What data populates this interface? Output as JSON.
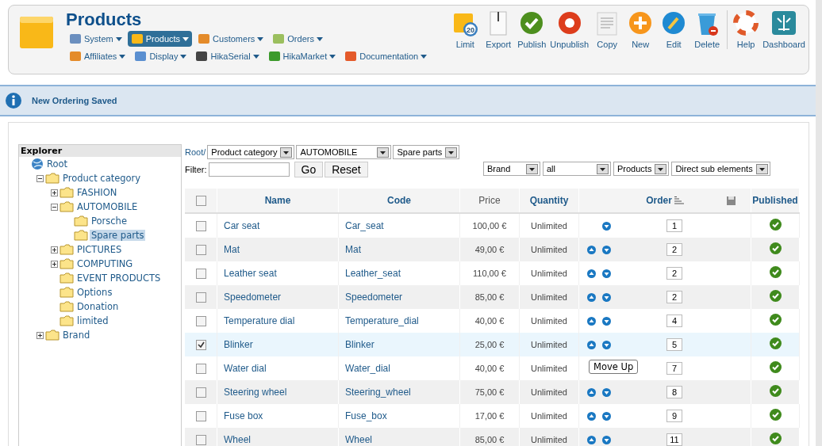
{
  "header": {
    "title": "Products",
    "menu_rows": [
      [
        {
          "label": "System",
          "selected": false
        },
        {
          "label": "Products",
          "selected": true
        },
        {
          "label": "Customers",
          "selected": false
        },
        {
          "label": "Orders",
          "selected": false
        }
      ],
      [
        {
          "label": "Affiliates",
          "selected": false
        },
        {
          "label": "Display",
          "selected": false
        },
        {
          "label": "HikaSerial",
          "selected": false
        },
        {
          "label": "HikaMarket",
          "selected": false
        },
        {
          "label": "Documentation",
          "selected": false
        }
      ]
    ],
    "toolbar": [
      {
        "label": "Limit",
        "badge": "20"
      },
      {
        "label": "Export"
      },
      {
        "label": "Publish"
      },
      {
        "label": "Unpublish"
      },
      {
        "label": "Copy"
      },
      {
        "label": "New"
      },
      {
        "label": "Edit"
      },
      {
        "label": "Delete"
      },
      {
        "label": "Help"
      },
      {
        "label": "Dashboard"
      }
    ]
  },
  "message": "New Ordering Saved",
  "explorer": {
    "title": "Explorer",
    "tree": [
      {
        "label": "Root",
        "kind": "root",
        "selected": false,
        "children": [
          {
            "label": "Product category",
            "kind": "folder",
            "selected": false,
            "expanded": true,
            "children": [
              {
                "label": "FASHION",
                "kind": "folder",
                "selected": false,
                "expanded": false
              },
              {
                "label": "AUTOMOBILE",
                "kind": "folder",
                "selected": false,
                "expanded": true,
                "children": [
                  {
                    "label": "Porsche",
                    "kind": "folder",
                    "selected": false
                  },
                  {
                    "label": "Spare parts",
                    "kind": "folder",
                    "selected": true
                  }
                ]
              },
              {
                "label": "PICTURES",
                "kind": "folder",
                "selected": false,
                "expanded": false
              },
              {
                "label": "COMPUTING",
                "kind": "folder",
                "selected": false,
                "expanded": false
              },
              {
                "label": "EVENT PRODUCTS",
                "kind": "folder",
                "selected": false
              },
              {
                "label": "Options",
                "kind": "folder",
                "selected": false
              },
              {
                "label": "Donation",
                "kind": "folder",
                "selected": false
              },
              {
                "label": "limited",
                "kind": "folder",
                "selected": false
              }
            ]
          },
          {
            "label": "Brand",
            "kind": "folder",
            "selected": false,
            "expanded": false
          }
        ]
      }
    ]
  },
  "breadcrumb": {
    "root": "Root/",
    "selects": [
      "Product category",
      "AUTOMOBILE",
      "Spare parts"
    ]
  },
  "filter": {
    "label": "Filter:",
    "buttons": [
      "Go",
      "Reset"
    ]
  },
  "filter_selects": [
    "Brand",
    "all",
    "Products",
    "Direct sub elements"
  ],
  "table": {
    "all_checked": false,
    "columns": [
      "Name",
      "Code",
      "Price",
      "Quantity",
      "Order",
      "Published"
    ],
    "rows": [
      {
        "name": "Car seat",
        "code": "Car_seat",
        "price": "100,00 €",
        "quantity": "Unlimited",
        "order": "1",
        "checked": false,
        "move_up": false,
        "move_down": true,
        "published": true
      },
      {
        "name": "Mat",
        "code": "Mat",
        "price": "49,00 €",
        "quantity": "Unlimited",
        "order": "2",
        "checked": false,
        "move_up": true,
        "move_down": true,
        "published": true
      },
      {
        "name": "Leather seat",
        "code": "Leather_seat",
        "price": "110,00 €",
        "quantity": "Unlimited",
        "order": "2",
        "checked": false,
        "move_up": true,
        "move_down": true,
        "published": true
      },
      {
        "name": "Speedometer",
        "code": "Speedometer",
        "price": "85,00 €",
        "quantity": "Unlimited",
        "order": "2",
        "checked": false,
        "move_up": true,
        "move_down": true,
        "published": true
      },
      {
        "name": "Temperature dial",
        "code": "Temperature_dial",
        "price": "40,00 €",
        "quantity": "Unlimited",
        "order": "4",
        "checked": false,
        "move_up": true,
        "move_down": true,
        "published": true
      },
      {
        "name": "Blinker",
        "code": "Blinker",
        "price": "25,00 €",
        "quantity": "Unlimited",
        "order": "5",
        "checked": true,
        "move_up": true,
        "move_down": true,
        "published": true
      },
      {
        "name": "Water dial",
        "code": "Water_dial",
        "price": "40,00 €",
        "quantity": "Unlimited",
        "order": "7",
        "checked": false,
        "move_up": false,
        "move_down": false,
        "published": true,
        "tooltip": "Move Up"
      },
      {
        "name": "Steering wheel",
        "code": "Steering_wheel",
        "price": "75,00 €",
        "quantity": "Unlimited",
        "order": "8",
        "checked": false,
        "move_up": true,
        "move_down": true,
        "published": true
      },
      {
        "name": "Fuse box",
        "code": "Fuse_box",
        "price": "17,00 €",
        "quantity": "Unlimited",
        "order": "9",
        "checked": false,
        "move_up": true,
        "move_down": true,
        "published": true
      },
      {
        "name": "Wheel",
        "code": "Wheel",
        "price": "85,00 €",
        "quantity": "Unlimited",
        "order": "11",
        "checked": false,
        "move_up": true,
        "move_down": true,
        "published": true
      }
    ]
  }
}
